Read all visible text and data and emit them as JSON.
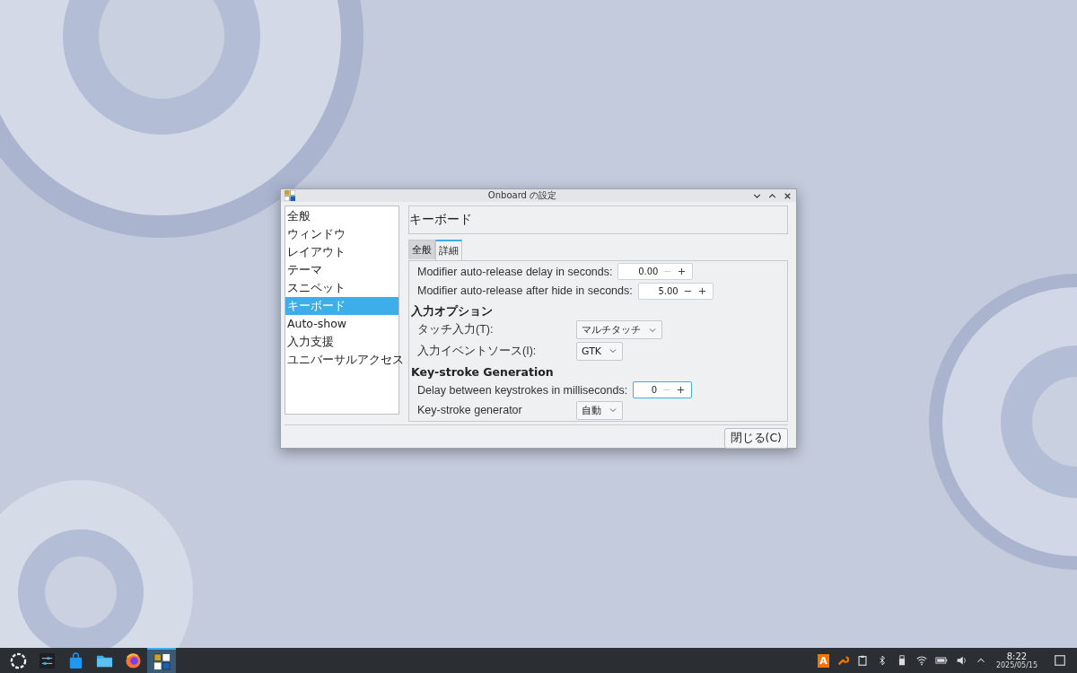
{
  "window": {
    "title": "Onboard の設定"
  },
  "sidebar": {
    "items": [
      {
        "label": "全般",
        "selected": false
      },
      {
        "label": "ウィンドウ",
        "selected": false
      },
      {
        "label": "レイアウト",
        "selected": false
      },
      {
        "label": "テーマ",
        "selected": false
      },
      {
        "label": "スニペット",
        "selected": false
      },
      {
        "label": "キーボード",
        "selected": true
      },
      {
        "label": "Auto-show",
        "selected": false
      },
      {
        "label": "入力支援",
        "selected": false
      },
      {
        "label": "ユニバーサルアクセス",
        "selected": false
      }
    ]
  },
  "page_title": "キーボード",
  "tabs": [
    {
      "label": "全般",
      "selected": false
    },
    {
      "label": "詳細",
      "selected": true
    }
  ],
  "settings": [
    {
      "kind": "spin",
      "label": "Modifier auto-release delay in seconds:",
      "value": "0.00",
      "focused": false,
      "decrement_disabled": true
    },
    {
      "kind": "spin",
      "label": "Modifier auto-release after hide in seconds:",
      "value": "5.00",
      "focused": false,
      "decrement_disabled": false
    },
    {
      "kind": "heading",
      "label": "入力オプション"
    },
    {
      "kind": "combo",
      "label": "タッチ入力(T):",
      "value": "マルチタッチ"
    },
    {
      "kind": "combo",
      "label": "入力イベントソース(I):",
      "value": "GTK"
    },
    {
      "kind": "heading",
      "label": "Key-stroke Generation"
    },
    {
      "kind": "spin",
      "label": "Delay between keystrokes in milliseconds:",
      "value": "0",
      "focused": true,
      "decrement_disabled": true
    },
    {
      "kind": "combo",
      "label": "Key-stroke generator",
      "value": "自動"
    }
  ],
  "close_button": "閉じる(C)",
  "taskbar": {
    "apps": [
      {
        "kind": "launcher",
        "selected": false
      },
      {
        "kind": "settings",
        "selected": false
      },
      {
        "kind": "store",
        "selected": false
      },
      {
        "kind": "files",
        "selected": false
      },
      {
        "kind": "browser",
        "selected": false
      },
      {
        "kind": "onboard",
        "selected": true
      }
    ],
    "input_method": "A",
    "time": "8:22",
    "date": "2025/05/15"
  }
}
